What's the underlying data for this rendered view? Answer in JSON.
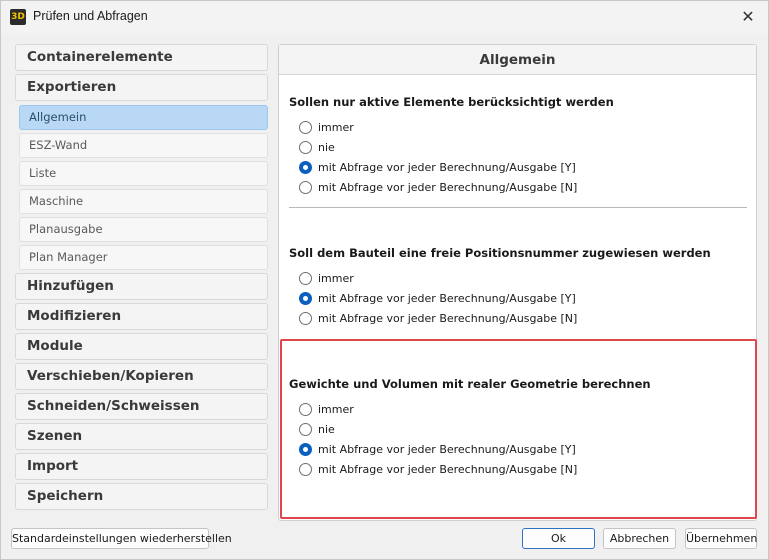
{
  "window": {
    "title": "Prüfen und Abfragen",
    "app_icon_label": "3D"
  },
  "nav": {
    "categories": [
      "Containerelemente",
      "Exportieren",
      "Hinzufügen",
      "Modifizieren",
      "Module",
      "Verschieben/Kopieren",
      "Schneiden/Schweissen",
      "Szenen",
      "Import",
      "Speichern"
    ],
    "export_subitems": [
      "Allgemein",
      "ESZ-Wand",
      "Liste",
      "Maschine",
      "Planausgabe",
      "Plan Manager"
    ],
    "selected": "Allgemein"
  },
  "panel": {
    "header": "Allgemein",
    "q1": {
      "title": "Sollen nur aktive Elemente berücksichtigt werden",
      "options": [
        "immer",
        "nie",
        "mit Abfrage vor jeder Berechnung/Ausgabe [Y]",
        "mit Abfrage vor jeder Berechnung/Ausgabe [N]"
      ],
      "selected_index": 2
    },
    "q2": {
      "title": "Soll dem Bauteil eine freie Positionsnummer zugewiesen werden",
      "options": [
        "immer",
        "mit Abfrage vor jeder Berechnung/Ausgabe [Y]",
        "mit Abfrage vor jeder Berechnung/Ausgabe [N]"
      ],
      "selected_index": 1
    },
    "q3": {
      "title": "Gewichte und Volumen mit realer Geometrie berechnen",
      "options": [
        "immer",
        "nie",
        "mit Abfrage vor jeder Berechnung/Ausgabe [Y]",
        "mit Abfrage vor jeder Berechnung/Ausgabe [N]"
      ],
      "selected_index": 2
    }
  },
  "footer": {
    "reset": "Standardeinstellungen wiederherstellen",
    "ok": "Ok",
    "cancel": "Abbrechen",
    "apply": "Übernehmen"
  },
  "colors": {
    "selected_nav": "#b9d8f5",
    "radio_checked": "#0a5fbf",
    "highlight_border": "#e0474c",
    "primary_border": "#2b73c6"
  }
}
